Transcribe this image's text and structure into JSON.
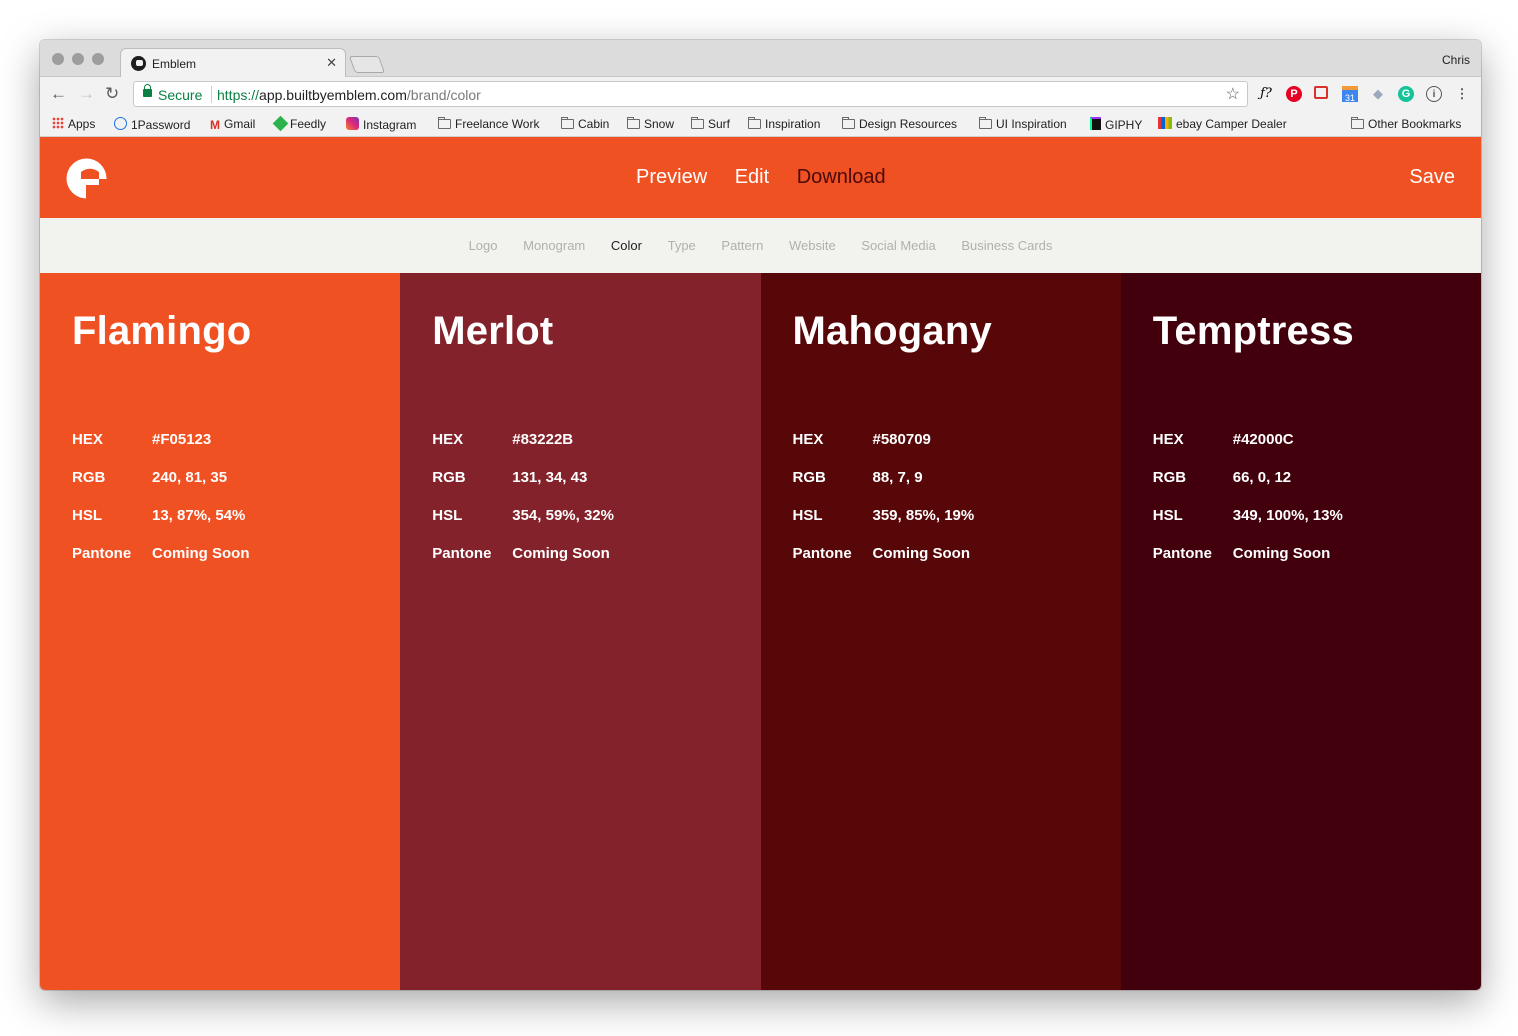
{
  "browser": {
    "tab_title": "Emblem",
    "profile_name": "Chris",
    "secure_label": "Secure",
    "url_scheme": "https://",
    "url_host": "app.builtbyemblem.com",
    "url_path": "/brand/color"
  },
  "bookmarks": {
    "items": [
      "Apps",
      "1Password",
      "Gmail",
      "Feedly",
      "Instagram",
      "Freelance Work",
      "Cabin",
      "Snow",
      "Surf",
      "Inspiration",
      "Design Resources",
      "UI Inspiration",
      "GIPHY",
      "ebay Camper Dealer"
    ],
    "other": "Other Bookmarks"
  },
  "app": {
    "brand_color": "#F05123",
    "nav": [
      "Preview",
      "Edit",
      "Download"
    ],
    "active_nav": "Download",
    "save_label": "Save",
    "subnav": [
      "Logo",
      "Monogram",
      "Color",
      "Type",
      "Pattern",
      "Website",
      "Social Media",
      "Business Cards"
    ],
    "active_subnav": "Color"
  },
  "labels": {
    "hex": "HEX",
    "rgb": "RGB",
    "hsl": "HSL",
    "pantone": "Pantone"
  },
  "colors": [
    {
      "name": "Flamingo",
      "hex": "#F05123",
      "rgb": "240, 81, 35",
      "hsl": "13, 87%, 54%",
      "pantone": "Coming Soon",
      "swatch": "#F05123"
    },
    {
      "name": "Merlot",
      "hex": "#83222B",
      "rgb": "131, 34, 43",
      "hsl": "354, 59%, 32%",
      "pantone": "Coming Soon",
      "swatch": "#83222B"
    },
    {
      "name": "Mahogany",
      "hex": "#580709",
      "rgb": "88, 7, 9",
      "hsl": "359, 85%, 19%",
      "pantone": "Coming Soon",
      "swatch": "#580709"
    },
    {
      "name": "Temptress",
      "hex": "#42000C",
      "rgb": "66, 0, 12",
      "hsl": "349, 100%, 13%",
      "pantone": "Coming Soon",
      "swatch": "#42000C"
    }
  ]
}
